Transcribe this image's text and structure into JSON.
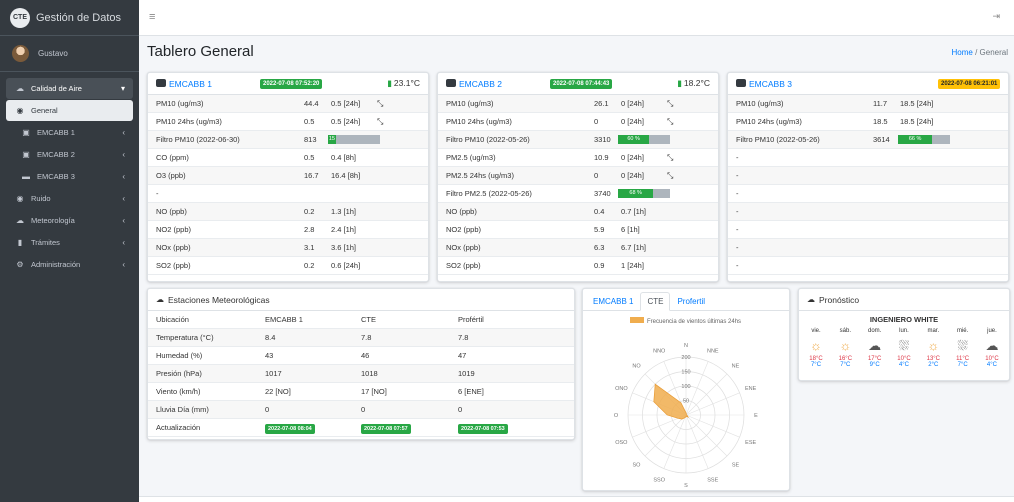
{
  "brand": {
    "logo": "CTE",
    "name": "Gestión de Datos"
  },
  "user": {
    "name": "Gustavo"
  },
  "nav": [
    {
      "label": "Calidad de Aire",
      "icon": "cloud-icon",
      "chev": "▾",
      "state": "open"
    },
    {
      "label": "General",
      "icon": "dashboard-icon",
      "chev": "",
      "state": "active"
    },
    {
      "label": "EMCABB 1",
      "icon": "bus-icon",
      "chev": "‹",
      "state": "sub"
    },
    {
      "label": "EMCABB 2",
      "icon": "bus-icon",
      "chev": "‹",
      "state": "sub"
    },
    {
      "label": "EMCABB 3",
      "icon": "car-icon",
      "chev": "‹",
      "state": "sub"
    },
    {
      "label": "Ruido",
      "icon": "location-icon",
      "chev": "‹",
      "state": ""
    },
    {
      "label": "Meteorología",
      "icon": "cloud-sun-icon",
      "chev": "‹",
      "state": ""
    },
    {
      "label": "Trámites",
      "icon": "chart-icon",
      "chev": "‹",
      "state": ""
    },
    {
      "label": "Administración",
      "icon": "gear-icon",
      "chev": "‹",
      "state": ""
    }
  ],
  "page": {
    "title": "Tablero General",
    "crumb_home": "Home",
    "crumb_sep": "/",
    "crumb_current": "General"
  },
  "stations": [
    {
      "name": "EMCABB 1",
      "date": "2022-07-08 07:52:20",
      "badge": "ok",
      "temp": "23.1°C",
      "rows": [
        {
          "label": "PM10 (ug/m3)",
          "v": "44.4",
          "avg": "0.5 [24h]",
          "dir": "ᯓ"
        },
        {
          "label": "PM10 24hs (ug/m3)",
          "v": "0.5",
          "avg": "0.5 [24h]",
          "dir": "ᯓ"
        },
        {
          "label": "Filtro PM10 (2022-06-30)",
          "v": "813",
          "bar": 0.15,
          "bartext": "15 %"
        },
        {
          "label": "CO (ppm)",
          "v": "0.5",
          "avg": "0.4 [8h]"
        },
        {
          "label": "O3 (ppb)",
          "v": "16.7",
          "avg": "16.4 [8h]"
        },
        {
          "label": "-"
        },
        {
          "label": "NO (ppb)",
          "v": "0.2",
          "avg": "1.3 [1h]"
        },
        {
          "label": "NO2 (ppb)",
          "v": "2.8",
          "avg": "2.4 [1h]"
        },
        {
          "label": "NOx (ppb)",
          "v": "3.1",
          "avg": "3.6 [1h]"
        },
        {
          "label": "SO2 (ppb)",
          "v": "0.2",
          "avg": "0.6 [24h]"
        }
      ]
    },
    {
      "name": "EMCABB 2",
      "date": "2022-07-08 07:44:43",
      "badge": "ok",
      "temp": "18.2°C",
      "rows": [
        {
          "label": "PM10 (ug/m3)",
          "v": "26.1",
          "avg": "0 [24h]",
          "dir": "ᯓ"
        },
        {
          "label": "PM10 24hs (ug/m3)",
          "v": "0",
          "avg": "0 [24h]",
          "dir": "ᯓ"
        },
        {
          "label": "Filtro PM10 (2022-05-26)",
          "v": "3310",
          "bar": 0.6,
          "bartext": "60 %"
        },
        {
          "label": "PM2.5 (ug/m3)",
          "v": "10.9",
          "avg": "0 [24h]",
          "dir": "ᯓ"
        },
        {
          "label": "PM2.5 24hs (ug/m3)",
          "v": "0",
          "avg": "0 [24h]",
          "dir": "ᯓ"
        },
        {
          "label": "Filtro PM2.5 (2022-05-26)",
          "v": "3740",
          "bar": 0.68,
          "bartext": "68 %"
        },
        {
          "label": "NO (ppb)",
          "v": "0.4",
          "avg": "0.7 [1h]"
        },
        {
          "label": "NO2 (ppb)",
          "v": "5.9",
          "avg": "6 [1h]"
        },
        {
          "label": "NOx (ppb)",
          "v": "6.3",
          "avg": "6.7 [1h]"
        },
        {
          "label": "SO2 (ppb)",
          "v": "0.9",
          "avg": "1 [24h]"
        }
      ]
    },
    {
      "name": "EMCABB 3",
      "date": "2022-07-08 06:21:01",
      "badge": "warn",
      "temp": "",
      "rows": [
        {
          "label": "PM10 (ug/m3)",
          "v": "11.7",
          "avg": "18.5 [24h]"
        },
        {
          "label": "PM10 24hs (ug/m3)",
          "v": "18.5",
          "avg": "18.5 [24h]"
        },
        {
          "label": "Filtro PM10 (2022-05-26)",
          "v": "3614",
          "bar": 0.66,
          "bartext": "66 %"
        },
        {
          "label": "-"
        },
        {
          "label": "-"
        },
        {
          "label": "-"
        },
        {
          "label": "-"
        },
        {
          "label": "-"
        },
        {
          "label": "-"
        },
        {
          "label": "-"
        }
      ]
    }
  ],
  "met": {
    "title": "Estaciones Meteorológicas",
    "headers": [
      "Ubicación",
      "EMCABB 1",
      "CTE",
      "Profértil"
    ],
    "rows": [
      [
        "Temperatura (°C)",
        "8.4",
        "7.8",
        "7.8"
      ],
      [
        "Humedad (%)",
        "43",
        "46",
        "47"
      ],
      [
        "Presión (hPa)",
        "1017",
        "1018",
        "1019"
      ],
      [
        "Viento (km/h)",
        "22 [NO]",
        "17 [NO]",
        "6 [ENE]"
      ],
      [
        "Lluvia Día (mm)",
        "0",
        "0",
        "0"
      ]
    ],
    "update_label": "Actualización",
    "updates": [
      "2022-07-08 08:04",
      "2022-07-08 07:57",
      "2022-07-08 07:53"
    ]
  },
  "wind": {
    "tabs": [
      "EMCABB 1",
      "CTE",
      "Profertil"
    ],
    "legend": "Frecuencia de vientos últimas 24hs",
    "directions": [
      "N",
      "NNE",
      "NE",
      "ENE",
      "E",
      "ESE",
      "SE",
      "SSE",
      "S",
      "SSO",
      "SO",
      "OSO",
      "O",
      "ONO",
      "NO",
      "NNO"
    ],
    "values": [
      8,
      4,
      2,
      2,
      2,
      5,
      10,
      5,
      6,
      10,
      20,
      30,
      65,
      120,
      150,
      45
    ],
    "ticks": [
      "200",
      "150",
      "100",
      "50"
    ],
    "max": 200,
    "fill": "#f0ad4e"
  },
  "forecast": {
    "title": "Pronóstico",
    "location": "INGENIERO WHITE",
    "days": [
      {
        "d": "vie.",
        "icon": "sun-icon",
        "hi": "18°C",
        "lo": "7°C"
      },
      {
        "d": "sáb.",
        "icon": "sun-icon",
        "hi": "16°C",
        "lo": "7°C"
      },
      {
        "d": "dom.",
        "icon": "cloud-icon",
        "hi": "17°C",
        "lo": "9°C"
      },
      {
        "d": "lun.",
        "icon": "rain-icon",
        "hi": "10°C",
        "lo": "4°C"
      },
      {
        "d": "mar.",
        "icon": "sun-icon",
        "hi": "13°C",
        "lo": "2°C"
      },
      {
        "d": "mié.",
        "icon": "rain-icon",
        "hi": "11°C",
        "lo": "7°C"
      },
      {
        "d": "jue.",
        "icon": "cloud-icon",
        "hi": "10°C",
        "lo": "4°C"
      }
    ]
  }
}
